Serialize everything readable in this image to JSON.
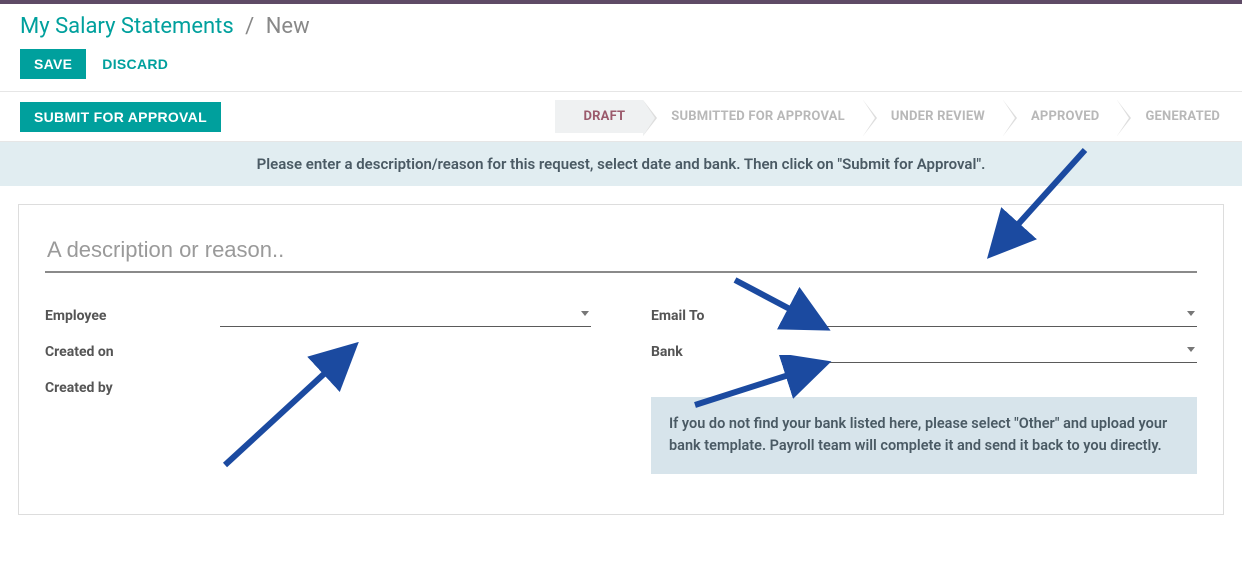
{
  "breadcrumb": {
    "main": "My Salary Statements",
    "sep": "/",
    "current": "New"
  },
  "header": {
    "save_label": "SAVE",
    "discard_label": "DISCARD"
  },
  "actions": {
    "submit_label": "SUBMIT FOR APPROVAL"
  },
  "status_steps": [
    {
      "label": "DRAFT",
      "active": true
    },
    {
      "label": "SUBMITTED FOR APPROVAL",
      "active": false
    },
    {
      "label": "UNDER REVIEW",
      "active": false
    },
    {
      "label": "APPROVED",
      "active": false
    },
    {
      "label": "GENERATED",
      "active": false
    }
  ],
  "banner": "Please enter a description/reason for this request, select date and bank. Then click on \"Submit for Approval\".",
  "form": {
    "description_placeholder": "A description or reason..",
    "left": {
      "employee_label": "Employee",
      "created_on_label": "Created on",
      "created_by_label": "Created by"
    },
    "right": {
      "email_to_label": "Email To",
      "bank_label": "Bank",
      "info_box": "If you do not find your bank listed here, please select \"Other\" and upload your bank template. Payroll team will complete it and send it back to you directly."
    }
  }
}
